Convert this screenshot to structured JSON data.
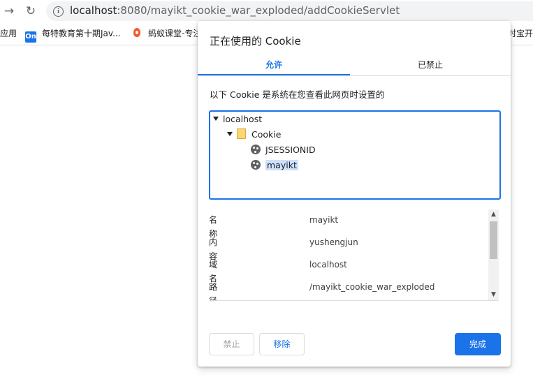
{
  "browser": {
    "url_host": "localhost",
    "url_path": ":8080/mayikt_cookie_war_exploded/addCookieServlet",
    "forward_glyph": "→",
    "reload_glyph": "↻",
    "info_glyph": "i"
  },
  "bookmarks": {
    "apps_label": "应用",
    "items": [
      {
        "label": "每特教育第十期Jav...",
        "icon": "on-icon",
        "icon_text": "On"
      },
      {
        "label": "蚂蚁课堂-专注",
        "icon": "ant-icon"
      },
      {
        "label": "时宝开",
        "icon": ""
      }
    ]
  },
  "dialog": {
    "title": "正在使用的 Cookie",
    "tabs": {
      "allowed": "允许",
      "blocked": "已禁止"
    },
    "description": "以下 Cookie 是系统在您查看此网页时设置的",
    "tree": {
      "site": "localhost",
      "folder": "Cookie",
      "cookies": [
        "JSESSIONID",
        "mayikt"
      ],
      "selected": "mayikt"
    },
    "details": [
      {
        "label": "名称",
        "value": "mayikt"
      },
      {
        "label": "内容",
        "value": "yushengjun"
      },
      {
        "label": "域名",
        "value": "localhost"
      },
      {
        "label": "路径",
        "value": "/mayikt_cookie_war_exploded"
      }
    ],
    "buttons": {
      "block": "禁止",
      "remove": "移除",
      "done": "完成"
    }
  },
  "colors": {
    "accent": "#1a73e8",
    "selection": "#cfe0fb",
    "folder": "#f8d775"
  }
}
